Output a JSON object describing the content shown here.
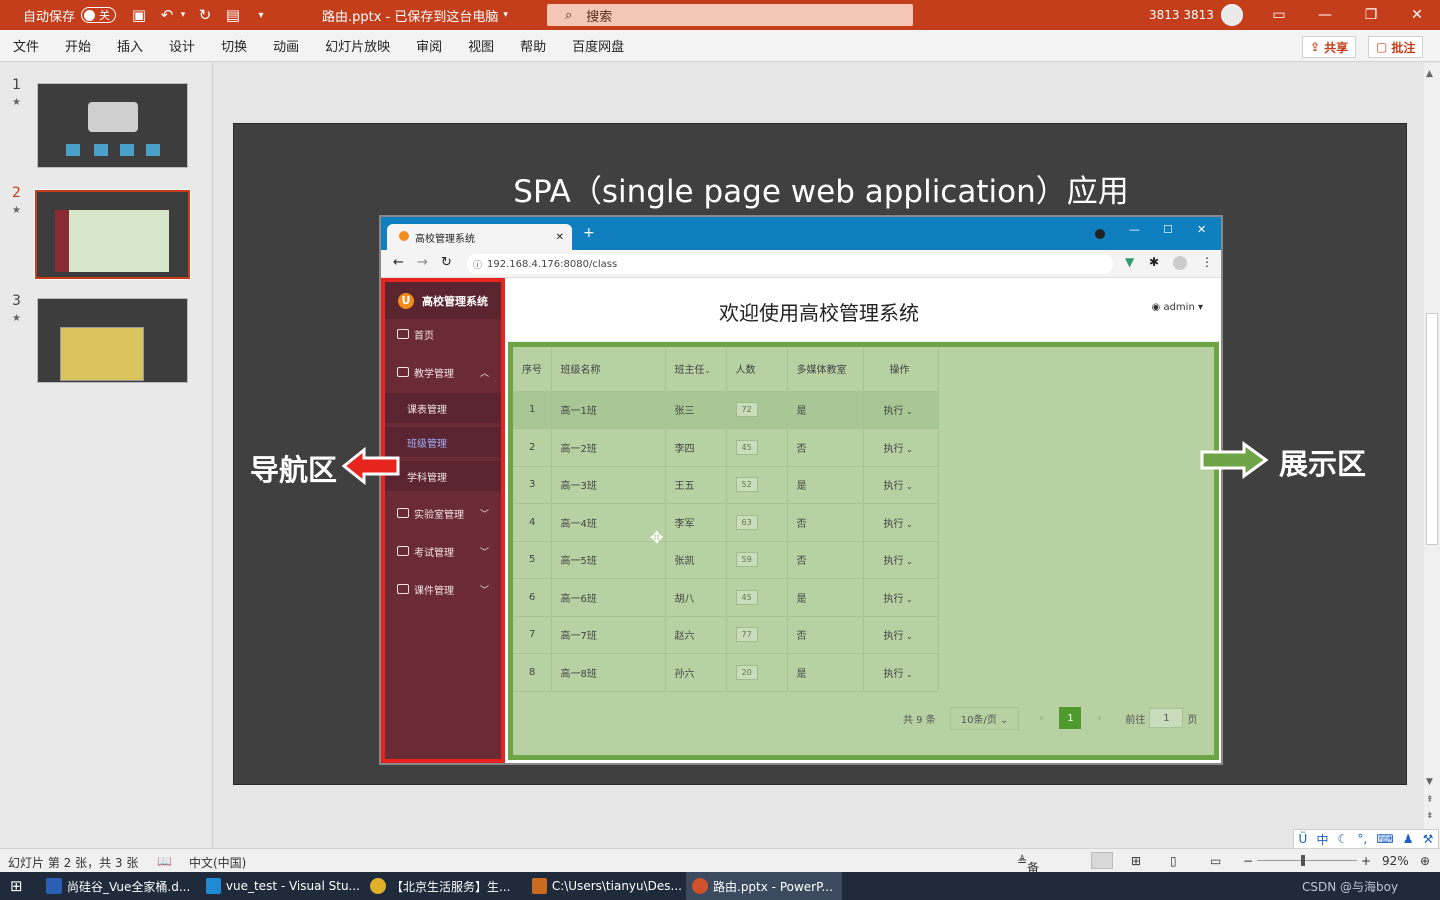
{
  "titlebar": {
    "autosave_label": "自动保存",
    "autosave_state": "关",
    "doc_title": "路由.pptx  -  已保存到这台电脑",
    "search_placeholder": "搜索",
    "user": "3813 3813"
  },
  "ribbon": {
    "tabs": [
      "文件",
      "开始",
      "插入",
      "设计",
      "切换",
      "动画",
      "幻灯片放映",
      "审阅",
      "视图",
      "帮助",
      "百度网盘"
    ],
    "share_label": "共享",
    "comment_label": "批注"
  },
  "thumbnails": [
    {
      "number": "1",
      "star": "★"
    },
    {
      "number": "2",
      "star": "★"
    },
    {
      "number": "3",
      "star": "★"
    }
  ],
  "slide": {
    "title": "SPA（single page web application）应用",
    "nav_label": "导航区",
    "display_label": "展示区",
    "browser": {
      "tab_title": "高校管理系统",
      "url": "192.168.4.176:8080/class",
      "app": {
        "logo": "U",
        "system_name": "高校管理系统",
        "menu": {
          "home": "首页",
          "teaching": "教学管理",
          "teaching_sub": [
            "课表管理",
            "班级管理",
            "学科管理"
          ],
          "lab": "实验室管理",
          "exam": "考试管理",
          "course": "课件管理"
        },
        "welcome": "欢迎使用高校管理系统",
        "admin": "admin",
        "table": {
          "headers": [
            "序号",
            "班级名称",
            "班主任",
            "人数",
            "多媒体教室",
            "操作"
          ],
          "rows": [
            [
              "1",
              "高一1班",
              "张三",
              "72",
              "是",
              "执行"
            ],
            [
              "2",
              "高一2班",
              "李四",
              "45",
              "否",
              "执行"
            ],
            [
              "3",
              "高一3班",
              "王五",
              "52",
              "是",
              "执行"
            ],
            [
              "4",
              "高一4班",
              "李军",
              "63",
              "否",
              "执行"
            ],
            [
              "5",
              "高一5班",
              "张凯",
              "59",
              "否",
              "执行"
            ],
            [
              "6",
              "高一6班",
              "胡八",
              "45",
              "是",
              "执行"
            ],
            [
              "7",
              "高一7班",
              "赵六",
              "77",
              "否",
              "执行"
            ],
            [
              "8",
              "高一8班",
              "孙六",
              "20",
              "是",
              "执行"
            ]
          ]
        },
        "pager": {
          "total": "共 9 条",
          "per_page": "10条/页",
          "current": "1",
          "goto_label": "前往",
          "goto_value": "1",
          "page_unit": "页"
        }
      }
    }
  },
  "statusbar": {
    "slide_info": "幻灯片 第 2 张，共 3 张",
    "language": "中文(中国)",
    "notes": "备注",
    "zoom": "92%"
  },
  "ime": {
    "lang": "中"
  },
  "taskbar": {
    "items": [
      "尚硅谷_Vue全家桶.d...",
      "vue_test - Visual Stu...",
      "【北京生活服务】生...",
      "C:\\Users\\tianyu\\Des...",
      "路由.pptx - PowerP..."
    ],
    "watermark": "CSDN @与海boy"
  },
  "colors": {
    "accent": "#c43e1c",
    "nav_border": "#e7241d",
    "display_border": "#6da445"
  }
}
